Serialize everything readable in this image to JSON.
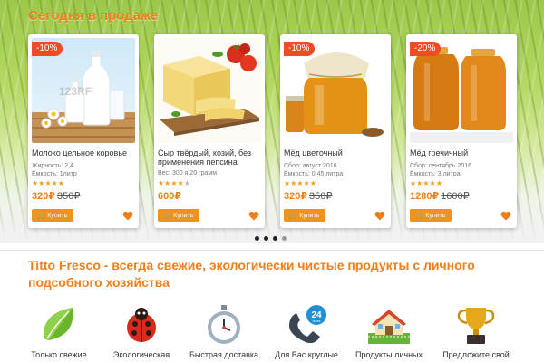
{
  "section_title": "Сегодня в продаже",
  "products": [
    {
      "badge": "-10%",
      "name": "Молоко цельное коровье",
      "meta1": "Жирность: 2,4",
      "meta2": "Ёмкость: 1литр",
      "rating": 5,
      "price": "320₽",
      "old_price": "350₽",
      "buy_label": "Купить",
      "image": "milk-bottles",
      "watermark": "123RF"
    },
    {
      "badge": "",
      "name": "Сыр твёрдый, козий, без применения пепсина",
      "meta1": "Вес: 300 я 20 грамм",
      "meta2": "",
      "rating": 4,
      "price": "600₽",
      "old_price": "",
      "buy_label": "Купить",
      "image": "cheese"
    },
    {
      "badge": "-10%",
      "name": "Мёд цветочный",
      "meta1": "Сбор: август 2016",
      "meta2": "Ёмкость: 0,45 литра",
      "rating": 5,
      "price": "320₽",
      "old_price": "350₽",
      "buy_label": "Купить",
      "image": "honey-jar"
    },
    {
      "badge": "-20%",
      "name": "Мёд гречичный",
      "meta1": "Сбор: сентябрь 2016",
      "meta2": "Ёмкость: 3 литра",
      "rating": 5,
      "price": "1280₽",
      "old_price": "1600₽",
      "buy_label": "Купить",
      "image": "honey-big-jars"
    }
  ],
  "slider_dots": {
    "count": 4,
    "active_index": 0
  },
  "headline": "Titto Fresco - всегда свежие, экологически чистые продукты с личного подсобного хозяйства",
  "features": [
    {
      "icon": "leaf-icon",
      "label": "Только свежие"
    },
    {
      "icon": "ladybug-icon",
      "label": "Экологическая"
    },
    {
      "icon": "stopwatch-icon",
      "label": "Быстрая доставка"
    },
    {
      "icon": "phone-24-icon",
      "label": "Для Вас круглые"
    },
    {
      "icon": "farmhouse-icon",
      "label": "Продукты личных"
    },
    {
      "icon": "trophy-icon",
      "label": "Предложите свой"
    }
  ],
  "phone_badge": "24",
  "phone_badge_sub": "hours",
  "colors": {
    "accent": "#f07f1b",
    "badge": "#f04b22",
    "button": "#f0921e",
    "heart": "#f07f1b",
    "star": "#f2a01a"
  }
}
